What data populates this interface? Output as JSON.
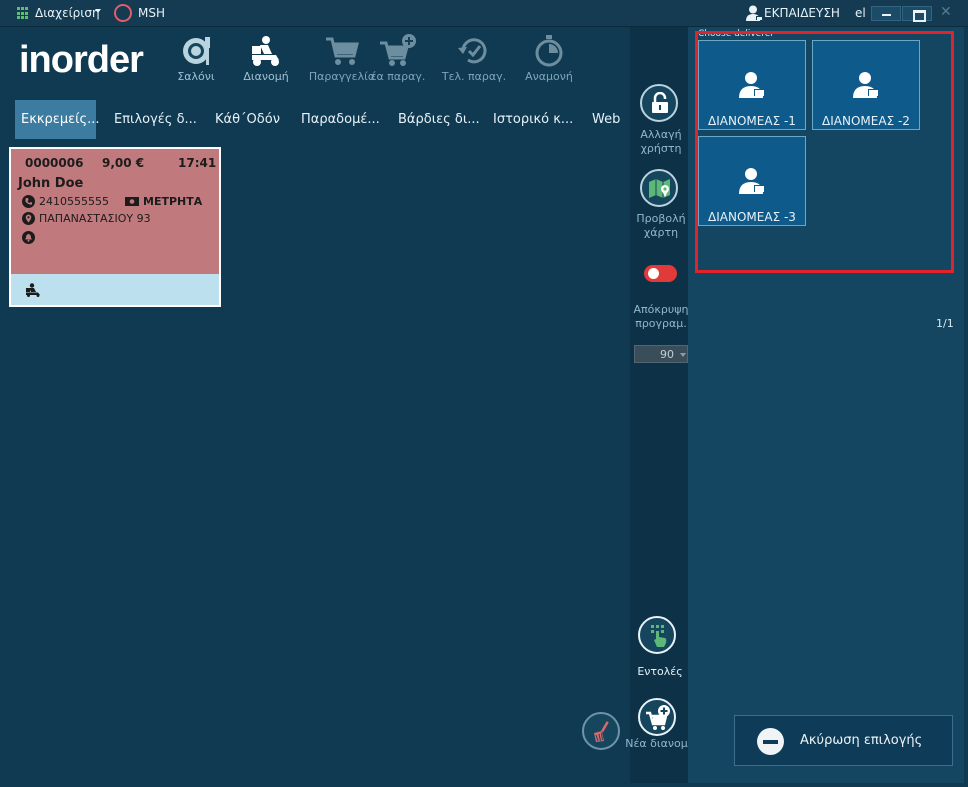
{
  "titlebar": {
    "admin_menu": "Διαχείριση",
    "store": "MSH",
    "user": "ΕΚΠΑΙΔΕΥΣΗ",
    "language": "el",
    "close_glyph": "✕"
  },
  "logo": {
    "text": "inorder"
  },
  "toolbar": {
    "items": [
      {
        "label": "Σαλόνι",
        "icon": "dining-icon"
      },
      {
        "label": "Διανομή",
        "icon": "delivery-scooter-icon"
      },
      {
        "label": "Παραγγελία",
        "icon": "cart-icon"
      },
      {
        "label": "έα παραγ.",
        "icon": "cart-plus-icon"
      },
      {
        "label": "Τελ. παραγ.",
        "icon": "history-check-icon"
      },
      {
        "label": "Αναμονή",
        "icon": "stopwatch-icon"
      }
    ]
  },
  "tabs": [
    "Εκκρεμείς...",
    "Επιλογές δ...",
    "Κάθ΄Οδόν",
    "Παραδομέ...",
    "Βάρδιες δι...",
    "Ιστορικό κ...",
    "Web"
  ],
  "order": {
    "number": "0000006",
    "amount": "9,00 €",
    "time": "17:41",
    "customer": "John Doe",
    "phone": "2410555555",
    "payment": "ΜΕΤΡΗΤΑ",
    "address": "ΠΑΠΑΝΑΣΤΑΣΙΟΥ 93",
    "card_color": "#c07a7e",
    "footer_color": "#bde0ef"
  },
  "side": {
    "change_user": "Αλλαγή χρήστη",
    "map_view": "Προβολή χάρτη",
    "hide_schedule": "Απόκρυψη προγραμ.",
    "hide_toggle_on": true,
    "numeric_value": "90",
    "commands": "Εντολές",
    "new_delivery": "Νέα διανομή"
  },
  "deliverers": {
    "label": "Choose deliverer",
    "items": [
      "ΔΙΑΝΟΜΕΑΣ -1",
      "ΔΙΑΝΟΜΕΑΣ -2",
      "ΔΙΑΝΟΜΕΑΣ -3"
    ],
    "page": "1/1",
    "cancel_button": "Ακύρωση επιλογής",
    "highlight_color": "#e0242a"
  }
}
